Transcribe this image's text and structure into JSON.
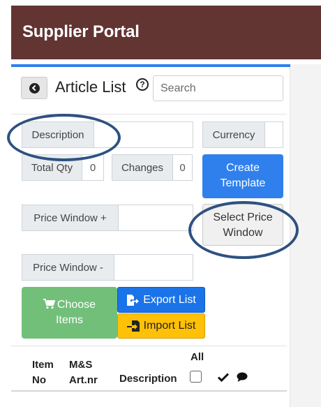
{
  "header": {
    "title": "Supplier Portal"
  },
  "toolbar": {
    "title": "Article List",
    "help": "?",
    "search_placeholder": "Search"
  },
  "fields": {
    "description_label": "Description",
    "currency_label": "Currency",
    "total_qty_label": "Total Qty",
    "total_qty_value": "0",
    "changes_label": "Changes",
    "changes_value": "0",
    "price_window_plus_label": "Price Window +",
    "price_window_minus_label": "Price Window -"
  },
  "buttons": {
    "create_template_line1": "Create",
    "create_template_line2": "Template",
    "select_price_window_line1": "Select Price",
    "select_price_window_line2": "Window",
    "choose_items_line1": "Choose",
    "choose_items_line2": "Items",
    "export_list": "Export List",
    "import_list": "Import List"
  },
  "table": {
    "columns": [
      {
        "line1": "Item",
        "line2": "No"
      },
      {
        "line1": "M&S",
        "line2": "Art.nr"
      },
      {
        "line1": "",
        "line2": "Description"
      },
      {
        "line1": "All",
        "line2": ""
      }
    ]
  },
  "icons": {
    "back": "chevron-left-circle-icon",
    "cart": "cart-icon",
    "export": "file-export-icon",
    "import": "file-import-icon",
    "check": "check-icon",
    "comment": "comment-icon"
  },
  "colors": {
    "header_bg": "#623432",
    "primary": "#2f80ed",
    "success": "#72bf7a",
    "warning": "#ffc107",
    "annotation": "#2e5180"
  }
}
